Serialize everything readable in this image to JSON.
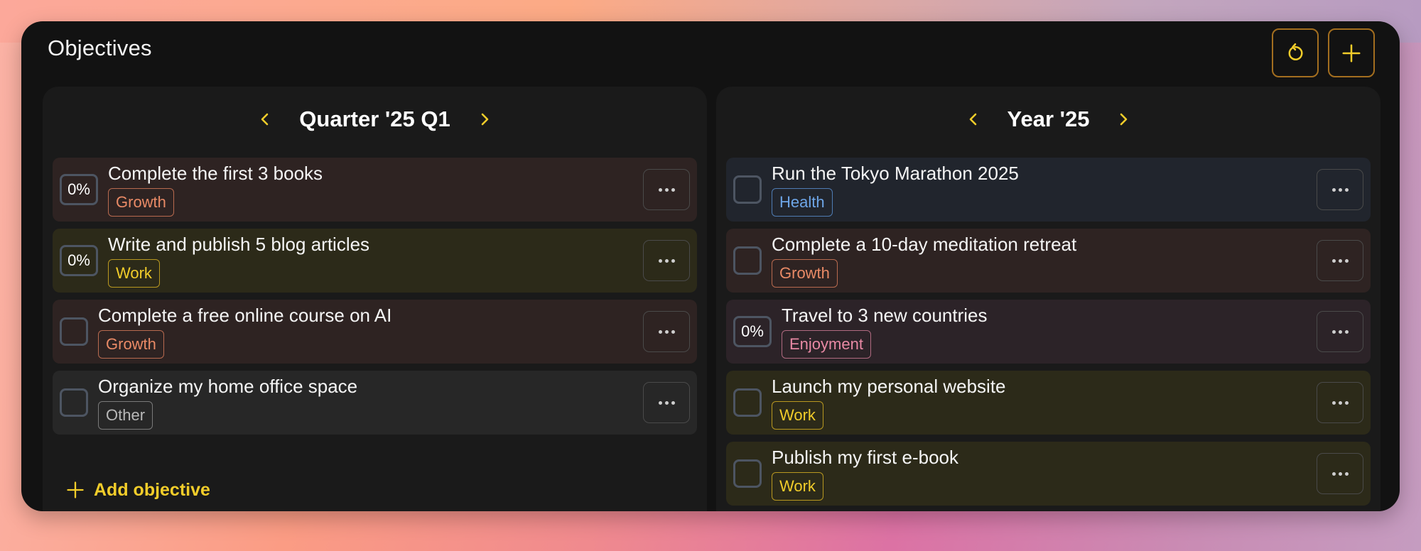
{
  "app": {
    "title": "Objectives",
    "reset_icon": "reset-icon",
    "add_icon": "plus-icon",
    "accent_color": "#f2cd2a"
  },
  "panels": [
    {
      "period_title": "Quarter '25 Q1",
      "prev_icon": "chevron-left-icon",
      "next_icon": "chevron-right-icon",
      "items": [
        {
          "title": "Complete the first 3 books",
          "tag": "Growth",
          "category": "growth",
          "status": "0%"
        },
        {
          "title": "Write and publish 5 blog articles",
          "tag": "Work",
          "category": "work",
          "status": "0%"
        },
        {
          "title": "Complete a free online course on AI",
          "tag": "Growth",
          "category": "growth",
          "status": ""
        },
        {
          "title": "Organize my home office space",
          "tag": "Other",
          "category": "other",
          "status": ""
        }
      ],
      "add_label": "Add objective"
    },
    {
      "period_title": "Year '25",
      "prev_icon": "chevron-left-icon",
      "next_icon": "chevron-right-icon",
      "items": [
        {
          "title": "Run the Tokyo Marathon 2025",
          "tag": "Health",
          "category": "health",
          "status": ""
        },
        {
          "title": "Complete a 10-day meditation retreat",
          "tag": "Growth",
          "category": "growth",
          "status": ""
        },
        {
          "title": "Travel to 3 new countries",
          "tag": "Enjoyment",
          "category": "enjoyment",
          "status": "0%"
        },
        {
          "title": "Launch my personal website",
          "tag": "Work",
          "category": "work",
          "status": ""
        },
        {
          "title": "Publish my first e-book",
          "tag": "Work",
          "category": "work",
          "status": ""
        }
      ]
    }
  ],
  "category_colors": {
    "growth": "#e98a66",
    "work": "#f2cd2a",
    "other": "#b8b8b8",
    "health": "#6ea6e8",
    "enjoyment": "#e889a4"
  }
}
